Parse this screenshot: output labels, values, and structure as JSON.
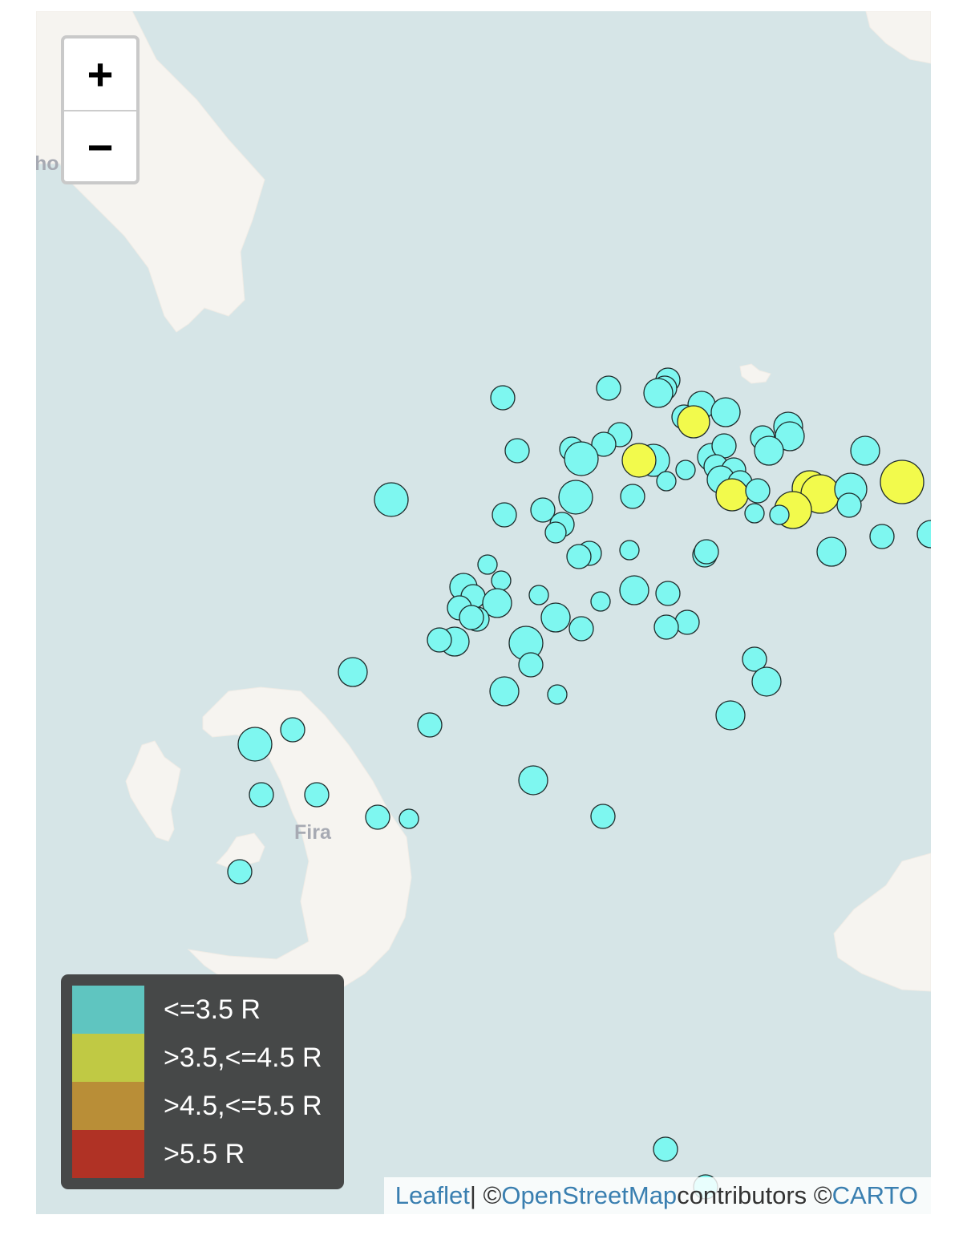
{
  "map": {
    "place_labels": [
      "Fira",
      "ho"
    ],
    "zoom": {
      "in_label": "+",
      "out_label": "−"
    }
  },
  "legend": {
    "items": [
      {
        "label": "<=3.5 R",
        "color": "#5fc5c0"
      },
      {
        "label": ">3.5,<=4.5 R",
        "color": "#c0c944"
      },
      {
        "label": ">4.5,<=5.5 R",
        "color": "#b98e37"
      },
      {
        "label": ">5.5 R",
        "color": "#b03225"
      }
    ]
  },
  "attribution": {
    "leaflet": "Leaflet",
    "separator": " | © ",
    "osm": "OpenStreetMap",
    "contributors": " contributors © ",
    "carto": "CARTO"
  },
  "marker_colors": {
    "low": "#7ef7f0",
    "mid": "#f2fa4c"
  }
}
